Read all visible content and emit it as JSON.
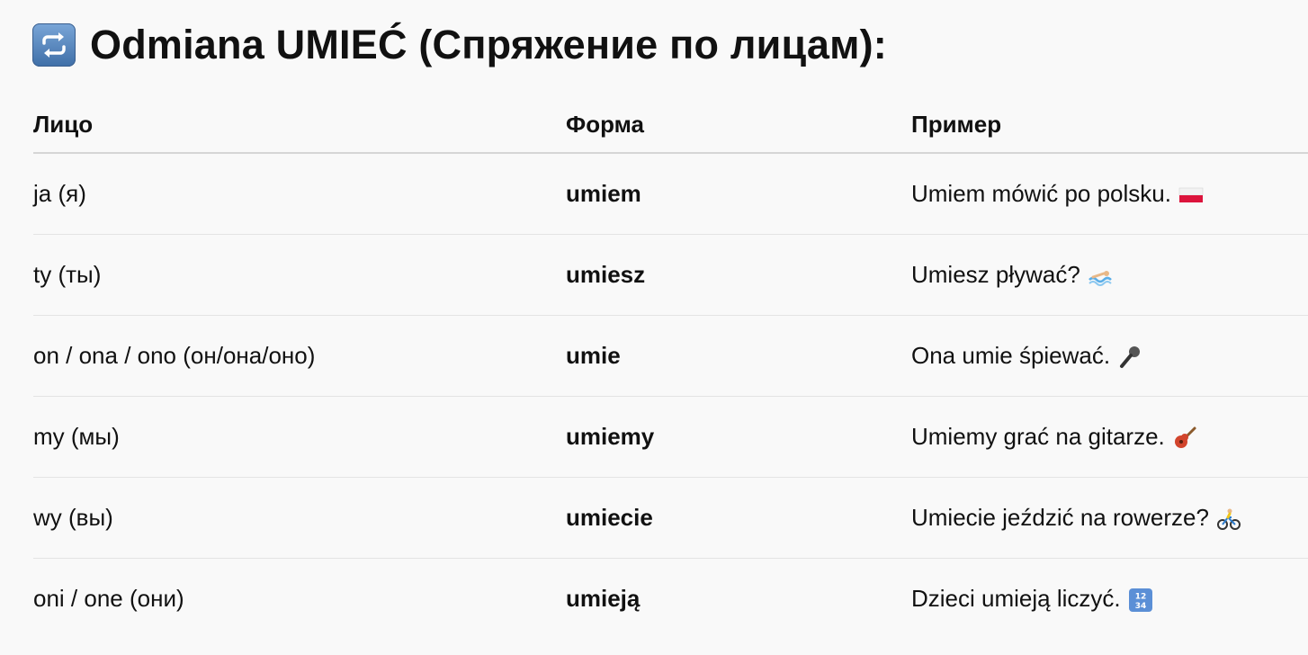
{
  "title": {
    "icon": "repeat-arrows-icon",
    "text": "Odmiana UMIEĆ (Спряжение по лицам):"
  },
  "table": {
    "headers": {
      "person": "Лицо",
      "form": "Форма",
      "example": "Пример"
    },
    "rows": [
      {
        "person": "ja (я)",
        "form": "umiem",
        "example": "Umiem mówić po polsku.",
        "emoji": "polish-flag-icon"
      },
      {
        "person": "ty (ты)",
        "form": "umiesz",
        "example": "Umiesz pływać?",
        "emoji": "swimmer-icon"
      },
      {
        "person": "on / ona / ono (он/она/оно)",
        "form": "umie",
        "example": "Ona umie śpiewać.",
        "emoji": "microphone-icon"
      },
      {
        "person": "my (мы)",
        "form": "umiemy",
        "example": "Umiemy grać na gitarze.",
        "emoji": "guitar-icon"
      },
      {
        "person": "wy (вы)",
        "form": "umiecie",
        "example": "Umiecie jeździć na rowerze?",
        "emoji": "cyclist-icon"
      },
      {
        "person": "oni / one (они)",
        "form": "umieją",
        "example": "Dzieci umieją liczyć.",
        "emoji": "numbers-1234-icon"
      }
    ]
  }
}
